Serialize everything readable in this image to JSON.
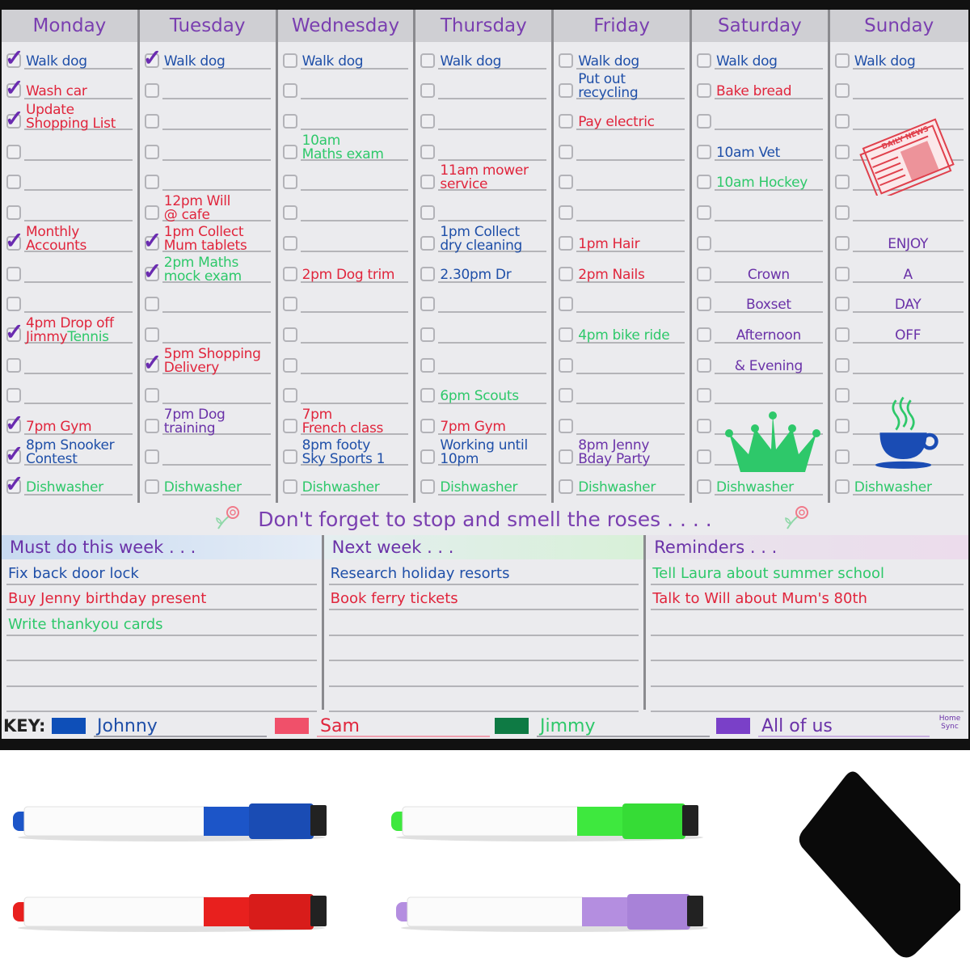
{
  "colors": {
    "johnny": "#1f4fa8",
    "sam": "#e0253c",
    "jimmy": "#2ec86a",
    "all_of_us": "#6a32a8",
    "key_johnny": "#0e4fb8",
    "key_sam": "#f0506a",
    "key_jimmy": "#0e7a44",
    "key_all": "#7a40c8"
  },
  "days": [
    {
      "name": "Monday",
      "rows": [
        {
          "checked": true,
          "text": "Walk dog",
          "color": "blue"
        },
        {
          "checked": true,
          "text": "Wash car",
          "color": "red"
        },
        {
          "checked": true,
          "text": "Update\nShopping List",
          "color": "red"
        },
        {
          "checked": false,
          "text": "",
          "color": ""
        },
        {
          "checked": false,
          "text": "",
          "color": ""
        },
        {
          "checked": false,
          "text": "",
          "color": ""
        },
        {
          "checked": true,
          "text": "Monthly\nAccounts",
          "color": "red"
        },
        {
          "checked": false,
          "text": "",
          "color": ""
        },
        {
          "checked": false,
          "text": "",
          "color": ""
        },
        {
          "checked": true,
          "text": "4pm Drop off\nJimmy",
          "extra": "Tennis",
          "color": "red"
        },
        {
          "checked": false,
          "text": "",
          "color": ""
        },
        {
          "checked": false,
          "text": "",
          "color": ""
        },
        {
          "checked": true,
          "text": "7pm Gym",
          "color": "red"
        },
        {
          "checked": true,
          "text": "8pm Snooker\nContest",
          "color": "blue"
        },
        {
          "checked": true,
          "text": "Dishwasher",
          "color": "green"
        }
      ]
    },
    {
      "name": "Tuesday",
      "rows": [
        {
          "checked": true,
          "text": "Walk dog",
          "color": "blue"
        },
        {
          "checked": false,
          "text": "",
          "color": ""
        },
        {
          "checked": false,
          "text": "",
          "color": ""
        },
        {
          "checked": false,
          "text": "",
          "color": ""
        },
        {
          "checked": false,
          "text": "",
          "color": ""
        },
        {
          "checked": false,
          "text": "12pm Will\n@ cafe",
          "color": "red"
        },
        {
          "checked": true,
          "text": "1pm Collect\nMum tablets",
          "color": "red"
        },
        {
          "checked": true,
          "text": "2pm Maths\nmock exam",
          "color": "green"
        },
        {
          "checked": false,
          "text": "",
          "color": ""
        },
        {
          "checked": false,
          "text": "",
          "color": ""
        },
        {
          "checked": true,
          "text": "5pm Shopping\nDelivery",
          "color": "red"
        },
        {
          "checked": false,
          "text": "",
          "color": ""
        },
        {
          "checked": false,
          "text": "7pm Dog\ntraining",
          "color": "purple"
        },
        {
          "checked": false,
          "text": "",
          "color": ""
        },
        {
          "checked": false,
          "text": "Dishwasher",
          "color": "green"
        }
      ]
    },
    {
      "name": "Wednesday",
      "rows": [
        {
          "checked": false,
          "text": "Walk dog",
          "color": "blue"
        },
        {
          "checked": false,
          "text": "",
          "color": ""
        },
        {
          "checked": false,
          "text": "",
          "color": ""
        },
        {
          "checked": false,
          "text": "10am\nMaths exam",
          "color": "green"
        },
        {
          "checked": false,
          "text": "",
          "color": ""
        },
        {
          "checked": false,
          "text": "",
          "color": ""
        },
        {
          "checked": false,
          "text": "",
          "color": ""
        },
        {
          "checked": false,
          "text": "2pm Dog trim",
          "color": "red"
        },
        {
          "checked": false,
          "text": "",
          "color": ""
        },
        {
          "checked": false,
          "text": "",
          "color": ""
        },
        {
          "checked": false,
          "text": "",
          "color": ""
        },
        {
          "checked": false,
          "text": "",
          "color": ""
        },
        {
          "checked": false,
          "text": "7pm\nFrench class",
          "color": "red"
        },
        {
          "checked": false,
          "text": "8pm footy\nSky Sports 1",
          "color": "blue"
        },
        {
          "checked": false,
          "text": "Dishwasher",
          "color": "green"
        }
      ]
    },
    {
      "name": "Thursday",
      "rows": [
        {
          "checked": false,
          "text": "Walk dog",
          "color": "blue"
        },
        {
          "checked": false,
          "text": "",
          "color": ""
        },
        {
          "checked": false,
          "text": "",
          "color": ""
        },
        {
          "checked": false,
          "text": "",
          "color": ""
        },
        {
          "checked": false,
          "text": "11am mower\nservice",
          "color": "red"
        },
        {
          "checked": false,
          "text": "",
          "color": ""
        },
        {
          "checked": false,
          "text": "1pm Collect\ndry cleaning",
          "color": "blue"
        },
        {
          "checked": false,
          "text": "2.30pm Dr",
          "color": "blue"
        },
        {
          "checked": false,
          "text": "",
          "color": ""
        },
        {
          "checked": false,
          "text": "",
          "color": ""
        },
        {
          "checked": false,
          "text": "",
          "color": ""
        },
        {
          "checked": false,
          "text": "6pm Scouts",
          "color": "green"
        },
        {
          "checked": false,
          "text": "7pm Gym",
          "color": "red"
        },
        {
          "checked": false,
          "text": "Working until\n10pm",
          "color": "blue"
        },
        {
          "checked": false,
          "text": "Dishwasher",
          "color": "green"
        }
      ]
    },
    {
      "name": "Friday",
      "rows": [
        {
          "checked": false,
          "text": "Walk dog",
          "color": "blue"
        },
        {
          "checked": false,
          "text": "Put out\nrecycling",
          "color": "blue"
        },
        {
          "checked": false,
          "text": "Pay electric",
          "color": "red"
        },
        {
          "checked": false,
          "text": "",
          "color": ""
        },
        {
          "checked": false,
          "text": "",
          "color": ""
        },
        {
          "checked": false,
          "text": "",
          "color": ""
        },
        {
          "checked": false,
          "text": "1pm Hair",
          "color": "red"
        },
        {
          "checked": false,
          "text": "2pm Nails",
          "color": "red"
        },
        {
          "checked": false,
          "text": "",
          "color": ""
        },
        {
          "checked": false,
          "text": "4pm bike ride",
          "color": "green"
        },
        {
          "checked": false,
          "text": "",
          "color": ""
        },
        {
          "checked": false,
          "text": "",
          "color": ""
        },
        {
          "checked": false,
          "text": "",
          "color": ""
        },
        {
          "checked": false,
          "text": "8pm Jenny\nBday Party",
          "color": "purple"
        },
        {
          "checked": false,
          "text": "Dishwasher",
          "color": "green"
        }
      ]
    },
    {
      "name": "Saturday",
      "rows": [
        {
          "checked": false,
          "text": "Walk dog",
          "color": "blue"
        },
        {
          "checked": false,
          "text": "Bake bread",
          "color": "red"
        },
        {
          "checked": false,
          "text": "",
          "color": ""
        },
        {
          "checked": false,
          "text": "10am Vet",
          "color": "blue"
        },
        {
          "checked": false,
          "text": "10am Hockey",
          "color": "green"
        },
        {
          "checked": false,
          "text": "",
          "color": ""
        },
        {
          "checked": false,
          "text": "",
          "color": ""
        },
        {
          "checked": false,
          "text": "Crown",
          "color": "purple",
          "center": true
        },
        {
          "checked": false,
          "text": "Boxset",
          "color": "purple",
          "center": true
        },
        {
          "checked": false,
          "text": "Afternoon",
          "color": "purple",
          "center": true
        },
        {
          "checked": false,
          "text": "& Evening",
          "color": "purple",
          "center": true
        },
        {
          "checked": false,
          "text": "",
          "color": ""
        },
        {
          "checked": false,
          "text": "",
          "color": ""
        },
        {
          "checked": false,
          "text": "",
          "color": ""
        },
        {
          "checked": false,
          "text": "Dishwasher",
          "color": "green"
        }
      ],
      "sticker": "crown-sticker"
    },
    {
      "name": "Sunday",
      "rows": [
        {
          "checked": false,
          "text": "Walk dog",
          "color": "blue"
        },
        {
          "checked": false,
          "text": "",
          "color": ""
        },
        {
          "checked": false,
          "text": "",
          "color": ""
        },
        {
          "checked": false,
          "text": "",
          "color": ""
        },
        {
          "checked": false,
          "text": "",
          "color": ""
        },
        {
          "checked": false,
          "text": "",
          "color": ""
        },
        {
          "checked": false,
          "text": "ENJOY",
          "color": "purple",
          "center": true
        },
        {
          "checked": false,
          "text": "A",
          "color": "purple",
          "center": true
        },
        {
          "checked": false,
          "text": "DAY",
          "color": "purple",
          "center": true
        },
        {
          "checked": false,
          "text": "OFF",
          "color": "purple",
          "center": true
        },
        {
          "checked": false,
          "text": "",
          "color": ""
        },
        {
          "checked": false,
          "text": "",
          "color": ""
        },
        {
          "checked": false,
          "text": "",
          "color": ""
        },
        {
          "checked": false,
          "text": "",
          "color": ""
        },
        {
          "checked": false,
          "text": "Dishwasher",
          "color": "green"
        }
      ],
      "stickers": [
        "newspaper-sticker",
        "teacup-sticker"
      ],
      "newspaper_label": "DAILY NEWS"
    }
  ],
  "motto": "Don't forget to stop and smell the roses . . . .",
  "lists": [
    {
      "title": "Must do this week . . .",
      "items": [
        {
          "text": "Fix back door lock",
          "color": "blue"
        },
        {
          "text": "Buy Jenny birthday present",
          "color": "red"
        },
        {
          "text": "Write thankyou cards",
          "color": "green"
        },
        {
          "text": "",
          "color": ""
        },
        {
          "text": "",
          "color": ""
        },
        {
          "text": "",
          "color": ""
        }
      ]
    },
    {
      "title": "Next week . . .",
      "items": [
        {
          "text": "Research holiday resorts",
          "color": "blue"
        },
        {
          "text": "Book ferry tickets",
          "color": "red"
        },
        {
          "text": "",
          "color": ""
        },
        {
          "text": "",
          "color": ""
        },
        {
          "text": "",
          "color": ""
        },
        {
          "text": "",
          "color": ""
        }
      ]
    },
    {
      "title": "Reminders . . .",
      "items": [
        {
          "text": "Tell Laura about summer school",
          "color": "green"
        },
        {
          "text": "Talk to Will about Mum's 80th",
          "color": "red"
        },
        {
          "text": "",
          "color": ""
        },
        {
          "text": "",
          "color": ""
        },
        {
          "text": "",
          "color": ""
        },
        {
          "text": "",
          "color": ""
        }
      ]
    }
  ],
  "key": {
    "label": "KEY:",
    "entries": [
      {
        "name": "Johnny",
        "swatch": "#0e4fb8",
        "text_color": "#1f4fa8"
      },
      {
        "name": "Sam",
        "swatch": "#f0506a",
        "text_color": "#e0253c"
      },
      {
        "name": "Jimmy",
        "swatch": "#0e7a44",
        "text_color": "#2ec86a"
      },
      {
        "name": "All of us",
        "swatch": "#7a40c8",
        "text_color": "#6a32a8"
      }
    ],
    "brand": "Home Sync"
  },
  "accessories": {
    "markers": [
      {
        "name": "blue-marker",
        "color": "#1c55c8"
      },
      {
        "name": "green-marker",
        "color": "#3ee83e"
      },
      {
        "name": "red-marker",
        "color": "#e8201e"
      },
      {
        "name": "purple-marker",
        "color": "#b48ee0"
      }
    ],
    "eraser": "black-magnetic-eraser"
  }
}
